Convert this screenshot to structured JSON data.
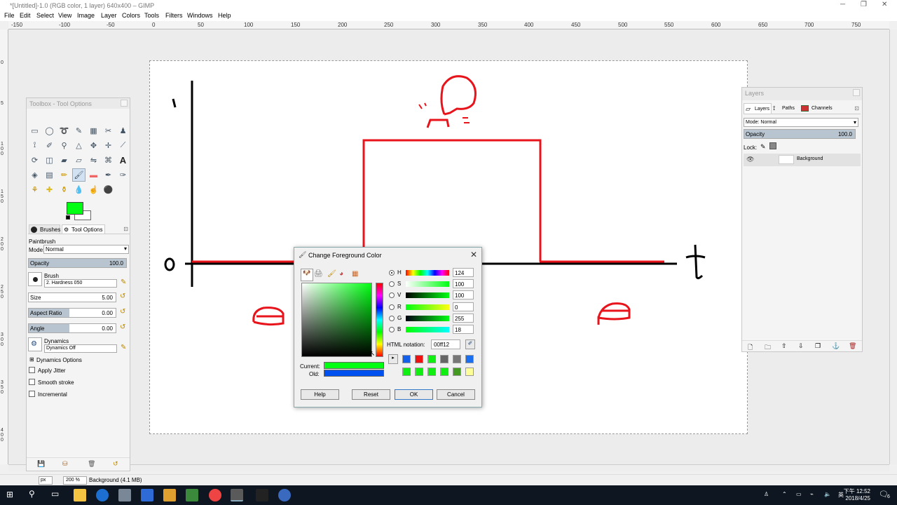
{
  "window": {
    "title": "*[Untitled]-1.0 (RGB color, 1 layer) 640x400 – GIMP"
  },
  "menu": [
    "File",
    "Edit",
    "Select",
    "View",
    "Image",
    "Layer",
    "Colors",
    "Tools",
    "Filters",
    "Windows",
    "Help"
  ],
  "ruler": {
    "h_labels": [
      "-150",
      "-100",
      "-50",
      "0",
      "50",
      "100",
      "150",
      "200",
      "250",
      "300",
      "350",
      "400",
      "450",
      "500",
      "550",
      "600",
      "650",
      "700",
      "750"
    ],
    "v_labels": [
      "0",
      "5",
      "1 0 0",
      "1 5 0",
      "2 0 0",
      "2 5 0",
      "3 0 0",
      "3 5 0",
      "4 0 0"
    ]
  },
  "toolbox": {
    "title": "Toolbox - Tool Options",
    "tabs": {
      "brushes": "Brushes",
      "tool_options": "Tool Options"
    },
    "paintbrush": "Paintbrush",
    "mode_label": "Mode:",
    "mode_value": "Normal",
    "opacity_label": "Opacity",
    "opacity_value": "100.0",
    "brush_label": "Brush",
    "brush_value": "2. Hardness 050",
    "size_label": "Size",
    "size_value": "5.00",
    "aspect_label": "Aspect Ratio",
    "aspect_value": "0.00",
    "angle_label": "Angle",
    "angle_value": "0.00",
    "dynamics_label": "Dynamics",
    "dynamics_value": "Dynamics Off",
    "dynamics_options": "Dynamics Options",
    "apply_jitter": "Apply Jitter",
    "smooth_stroke": "Smooth stroke",
    "incremental": "Incremental",
    "fg_color": "#00ff12",
    "bg_color": "#ffffff"
  },
  "layers": {
    "title": "Layers",
    "tabs": {
      "layers": "Layers",
      "paths": "Paths",
      "channels": "Channels"
    },
    "mode": "Mode: Normal",
    "opacity_label": "Opacity",
    "opacity_value": "100.0",
    "lock_label": "Lock:",
    "layer_name": "Background"
  },
  "canvas_text": {
    "y_mark": "1",
    "origin": "0",
    "t_mark": "t"
  },
  "dialog": {
    "title": "Change Foreground Color",
    "channels": [
      {
        "key": "H",
        "value": "124",
        "selected": true
      },
      {
        "key": "S",
        "value": "100",
        "selected": false
      },
      {
        "key": "V",
        "value": "100",
        "selected": false
      },
      {
        "key": "R",
        "value": "0",
        "selected": false
      },
      {
        "key": "G",
        "value": "255",
        "selected": false
      },
      {
        "key": "B",
        "value": "18",
        "selected": false
      }
    ],
    "html_notation_label": "HTML notation:",
    "html_notation_value": "00ff12",
    "current_label": "Current:",
    "old_label": "Old:",
    "current_color": "#00ff12",
    "old_color": "#0050f0",
    "history_colors": [
      "#1560e8",
      "#ee1111",
      "#11ee11",
      "#666666",
      "#777777",
      "#1a6ef0",
      "#11ee11",
      "#11ee11",
      "#11ee11",
      "#11ee11",
      "#449922",
      "#ffff99"
    ],
    "buttons": {
      "help": "Help",
      "reset": "Reset",
      "ok": "OK",
      "cancel": "Cancel"
    }
  },
  "statusbar": {
    "unit": "px",
    "zoom": "200 %",
    "info": "Background (4.1 MB)"
  },
  "taskbar": {
    "time": "下午 12:52",
    "date": "2018/4/25",
    "lang": "英",
    "notif": "6"
  }
}
